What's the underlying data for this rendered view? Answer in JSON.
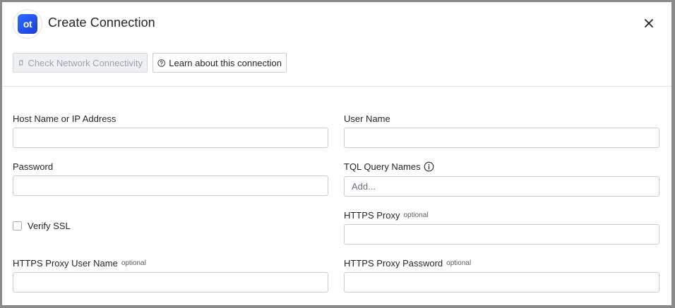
{
  "dialog": {
    "title": "Create Connection",
    "logo_text": "ot",
    "close_icon": "close-icon"
  },
  "toolbar": {
    "check_network_label": "Check Network Connectivity",
    "check_network_icon": "network-check-icon",
    "check_network_disabled": true,
    "learn_label": "Learn about this connection",
    "learn_icon": "help-circle-icon"
  },
  "form": {
    "host": {
      "label": "Host Name or IP Address",
      "value": ""
    },
    "user_name": {
      "label": "User Name",
      "value": ""
    },
    "password": {
      "label": "Password",
      "value": ""
    },
    "tql_query_names": {
      "label": "TQL Query Names",
      "placeholder": "Add...",
      "info_icon": "info-icon"
    },
    "verify_ssl": {
      "label": "Verify SSL",
      "checked": false
    },
    "https_proxy": {
      "label": "HTTPS Proxy",
      "optional": "optional",
      "value": ""
    },
    "https_proxy_user": {
      "label": "HTTPS Proxy User Name",
      "optional": "optional",
      "value": ""
    },
    "https_proxy_password": {
      "label": "HTTPS Proxy Password",
      "optional": "optional",
      "value": ""
    }
  },
  "colors": {
    "brand": "#2f6bff",
    "border": "#c9ccd1",
    "disabled_bg": "#eef0f4"
  }
}
